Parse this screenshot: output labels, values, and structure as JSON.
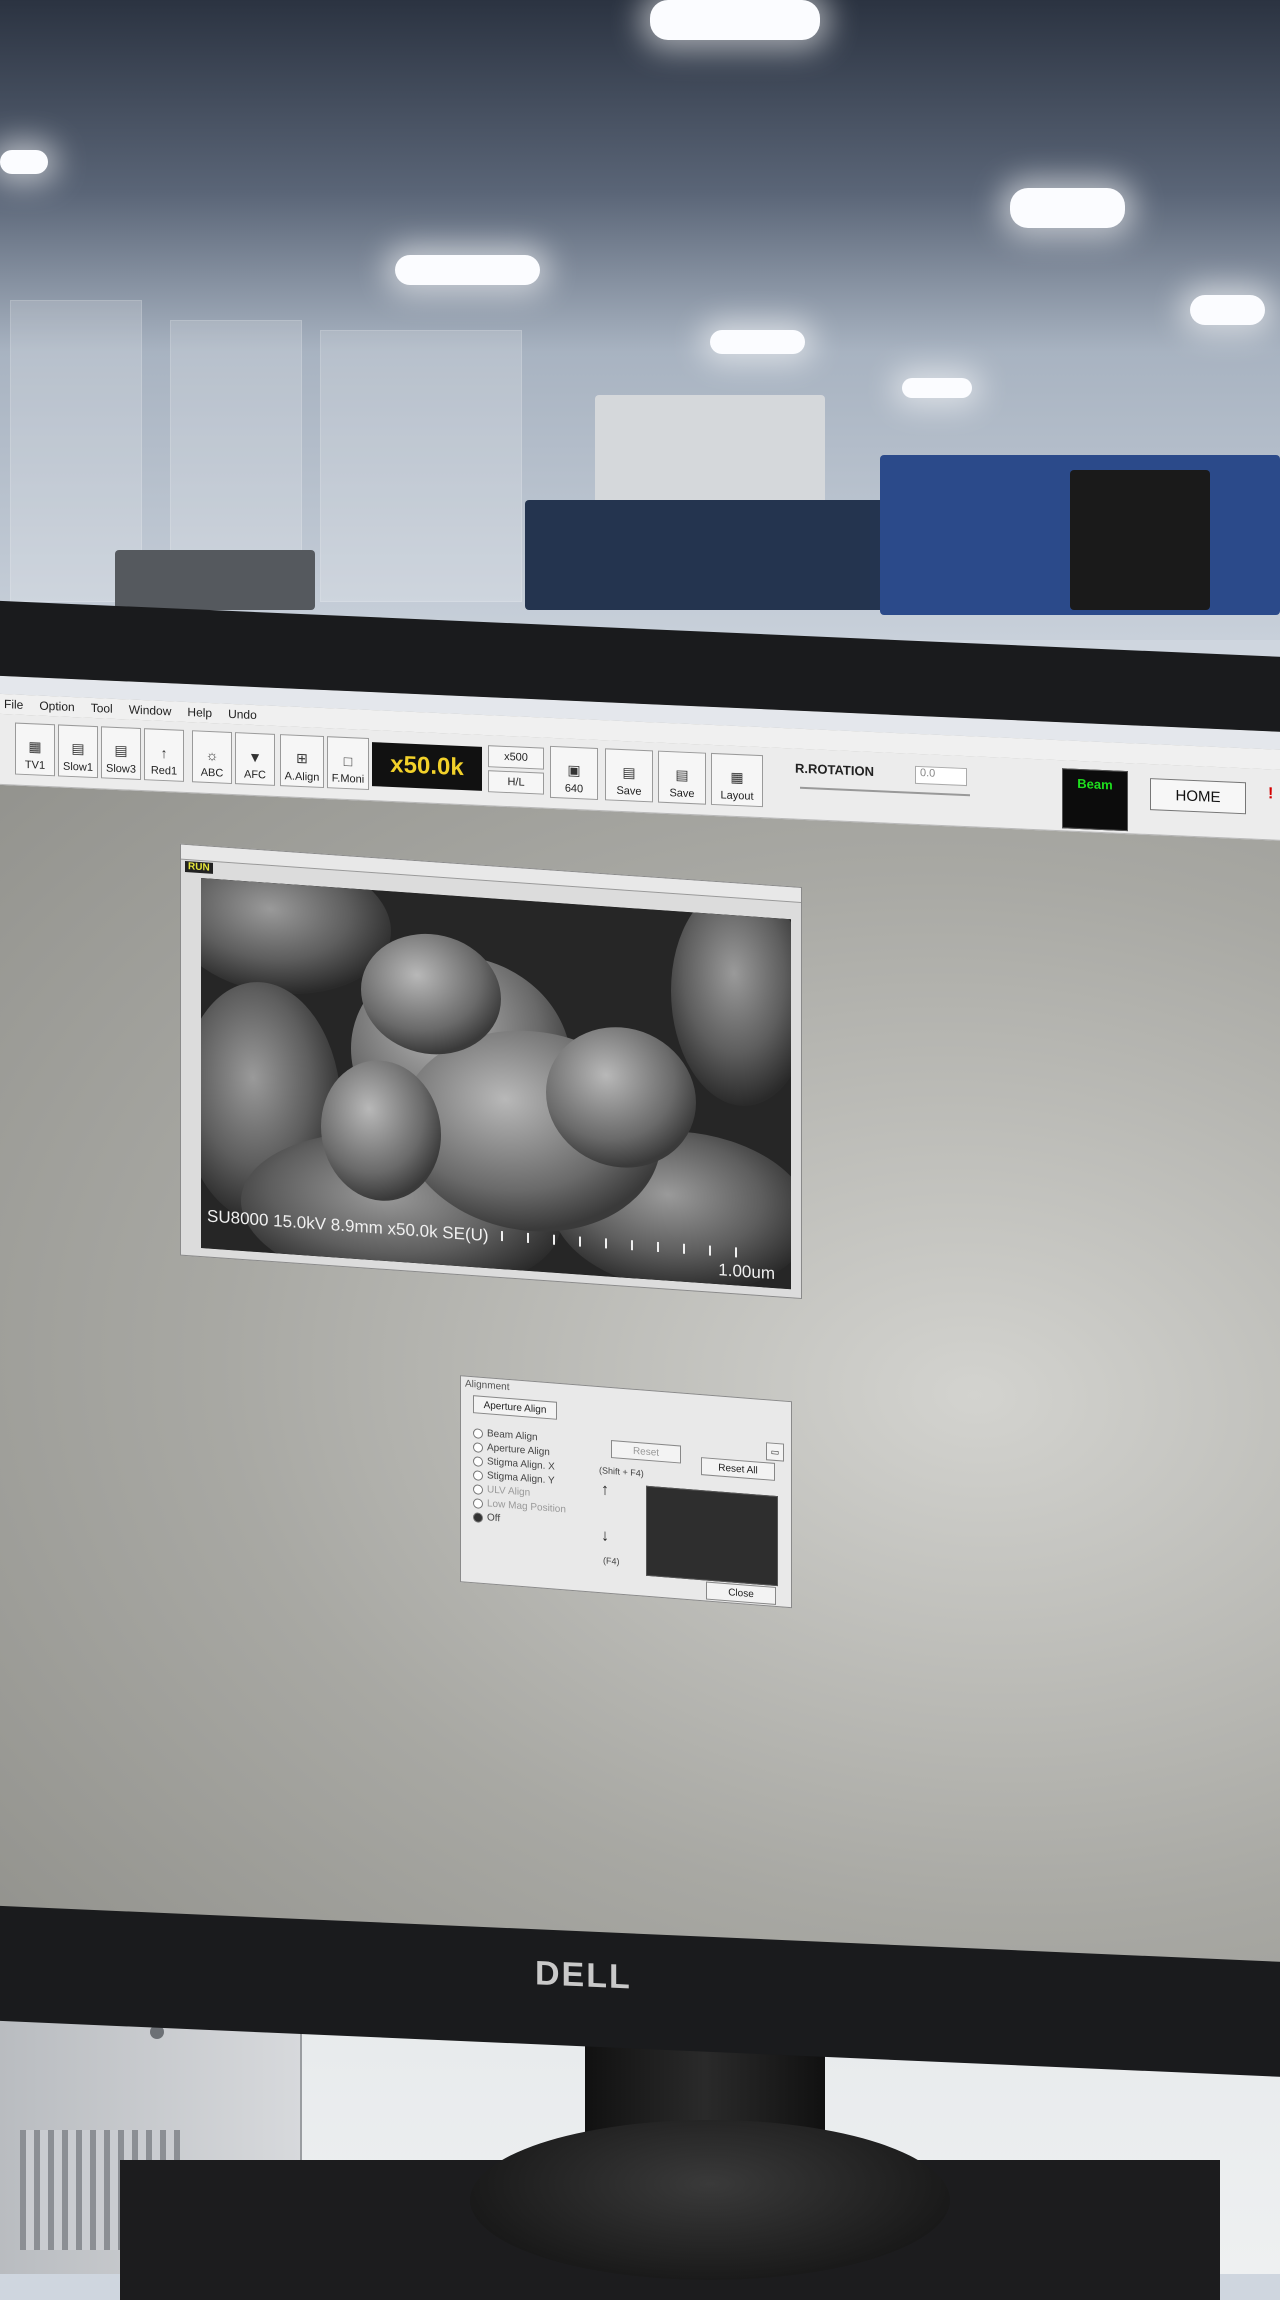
{
  "app": {
    "menu": [
      "File",
      "Option",
      "Tool",
      "Window",
      "Help",
      "Undo"
    ]
  },
  "toolbar": {
    "buttons": [
      {
        "label": "TV1",
        "icon": "scan-icon"
      },
      {
        "label": "Slow1",
        "icon": "scan-icon"
      },
      {
        "label": "Slow3",
        "icon": "scan-icon"
      },
      {
        "label": "Red1",
        "icon": "arrow-up-icon"
      },
      {
        "label": "ABC",
        "icon": "brightness-icon"
      },
      {
        "label": "AFC",
        "icon": "focus-icon"
      },
      {
        "label": "A.Align",
        "icon": "align-icon"
      },
      {
        "label": "F.Moni",
        "icon": "monitor-icon"
      }
    ],
    "magnification": "x50.0k",
    "mag_preset": "x500",
    "hl_label": "H/L",
    "resolution": "640",
    "save_d_label": "Save",
    "save_q_label": "Save",
    "layout_label": "Layout",
    "rotation_label": "R.ROTATION",
    "rotation_value": "0.0",
    "beam_label": "Beam",
    "home_label": "HOME",
    "alert": "!"
  },
  "sem_window": {
    "status": "RUN",
    "info_text": "SU8000 15.0kV 8.9mm x50.0k SE(U)",
    "scale_bar": "1.00um"
  },
  "alignment_dialog": {
    "title": "Alignment",
    "aperture_align_label": "Aperture Align",
    "reset_label": "Reset",
    "reset_all_label": "Reset All",
    "shift_hint": "(Shift + F4)",
    "f4_hint": "(F4)",
    "close_label": "Close",
    "options": [
      {
        "label": "Beam Align",
        "selected": false,
        "enabled": true
      },
      {
        "label": "Aperture Align",
        "selected": false,
        "enabled": true
      },
      {
        "label": "Stigma Align. X",
        "selected": false,
        "enabled": true
      },
      {
        "label": "Stigma Align. Y",
        "selected": false,
        "enabled": true
      },
      {
        "label": "ULV Align",
        "selected": false,
        "enabled": false
      },
      {
        "label": "Low Mag Position",
        "selected": false,
        "enabled": false
      },
      {
        "label": "Off",
        "selected": true,
        "enabled": true
      }
    ]
  },
  "monitor": {
    "brand": "DELL"
  }
}
